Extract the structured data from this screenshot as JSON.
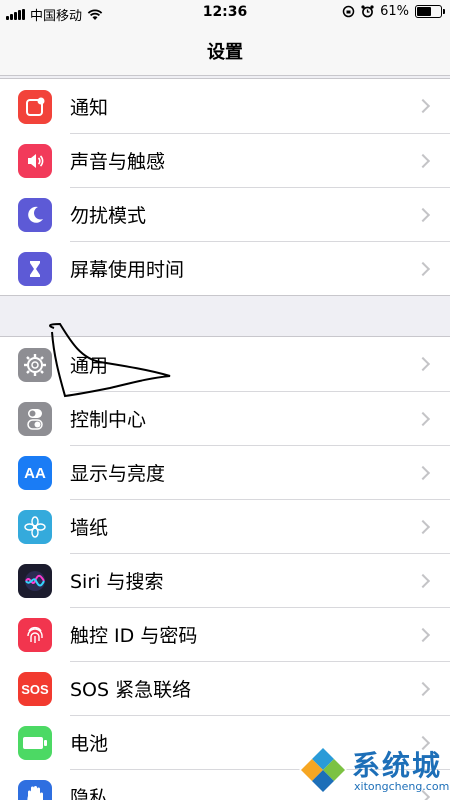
{
  "status_bar": {
    "carrier": "中国移动",
    "time": "12:36",
    "battery_percent": "61%",
    "battery_level": 0.61
  },
  "nav": {
    "title": "设置"
  },
  "group1": [
    {
      "label": "通知",
      "icon": "notification-icon",
      "color": "#f2433a"
    },
    {
      "label": "声音与触感",
      "icon": "speaker-icon",
      "color": "#f23a5a"
    },
    {
      "label": "勿扰模式",
      "icon": "moon-icon",
      "color": "#5d5ad6"
    },
    {
      "label": "屏幕使用时间",
      "icon": "hourglass-icon",
      "color": "#5d5ad6"
    }
  ],
  "group2": [
    {
      "label": "通用",
      "icon": "gear-icon",
      "color": "#8e8e93"
    },
    {
      "label": "控制中心",
      "icon": "toggles-icon",
      "color": "#8e8e93"
    },
    {
      "label": "显示与亮度",
      "icon": "text-size-icon",
      "glyph": "AA",
      "color": "#1a7cf5"
    },
    {
      "label": "墙纸",
      "icon": "flower-icon",
      "color": "#34aadc"
    },
    {
      "label": "Siri 与搜索",
      "icon": "siri-icon",
      "color": "#1c1c2e"
    },
    {
      "label": "触控 ID 与密码",
      "icon": "fingerprint-icon",
      "color": "#f2354e"
    },
    {
      "label": "SOS 紧急联络",
      "icon": "sos-icon",
      "glyph": "SOS",
      "color": "#f23a2f"
    },
    {
      "label": "电池",
      "icon": "battery-icon",
      "color": "#4cd964"
    },
    {
      "label": "隐私",
      "icon": "hand-icon",
      "color": "#2f6fe0"
    }
  ],
  "watermark": {
    "text": "系统城",
    "url": "xitongcheng.com"
  }
}
